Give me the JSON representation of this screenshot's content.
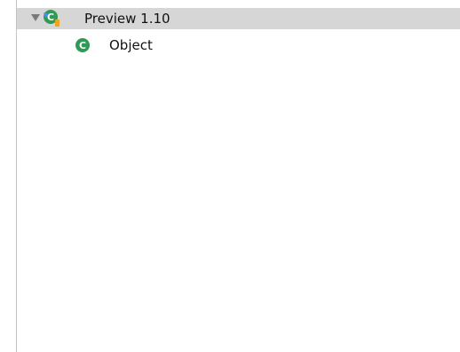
{
  "tree": {
    "root": {
      "label": "Preview  1.10",
      "icon": "class-with-badge-icon",
      "expanded": true,
      "selected": true
    },
    "children": [
      {
        "label": "Object",
        "icon": "class-icon"
      }
    ]
  },
  "colors": {
    "selection_bg": "#d6d6d6",
    "class_icon_green": "#2f9a55",
    "badge_orange": "#f0a321",
    "border": "#c4c4c4"
  }
}
